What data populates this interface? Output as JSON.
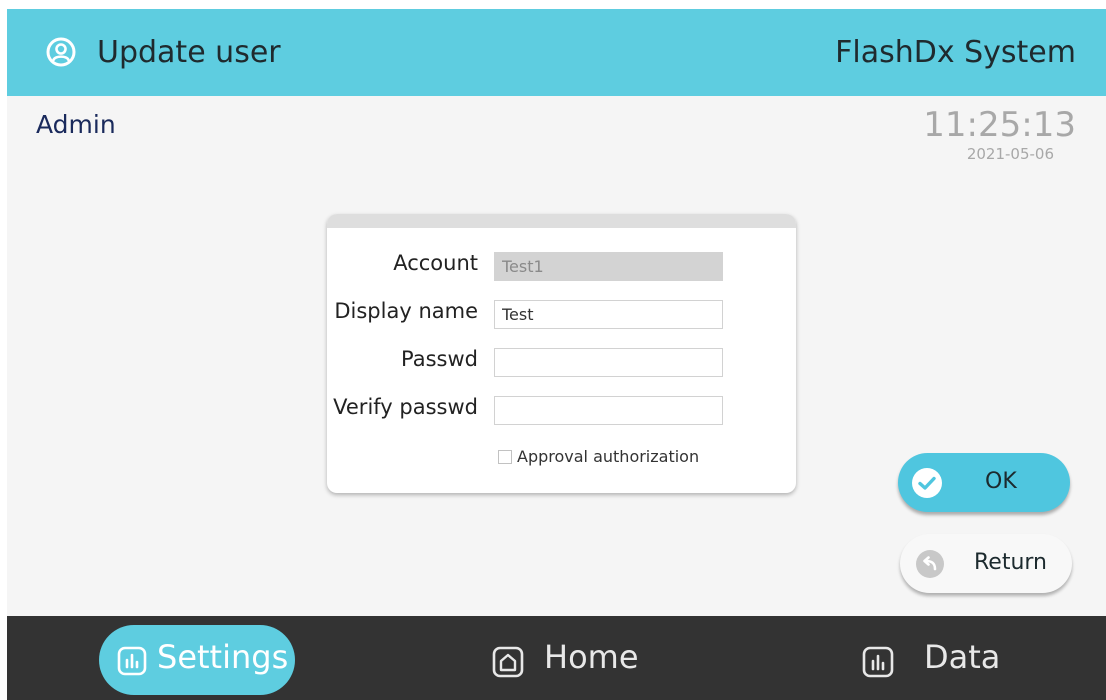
{
  "header": {
    "title": "Update user",
    "brand": "FlashDx System",
    "user_icon": "user-circle-icon"
  },
  "session": {
    "user": "Admin",
    "time": "11:25:13",
    "date": "2021-05-06"
  },
  "form": {
    "account_label": "Account",
    "account_value": "Test1",
    "display_name_label": "Display name",
    "display_name_value": "Test",
    "passwd_label": "Passwd",
    "passwd_value": "",
    "verify_label": "Verify passwd",
    "verify_value": "",
    "approval_label": "Approval authorization",
    "approval_checked": false
  },
  "actions": {
    "ok_label": "OK",
    "return_label": "Return"
  },
  "nav": {
    "settings": "Settings",
    "home": "Home",
    "data": "Data",
    "active": "settings"
  },
  "colors": {
    "accent": "#5ecde0",
    "bottom_bar": "#333333",
    "ok_button": "#4fc6df"
  }
}
